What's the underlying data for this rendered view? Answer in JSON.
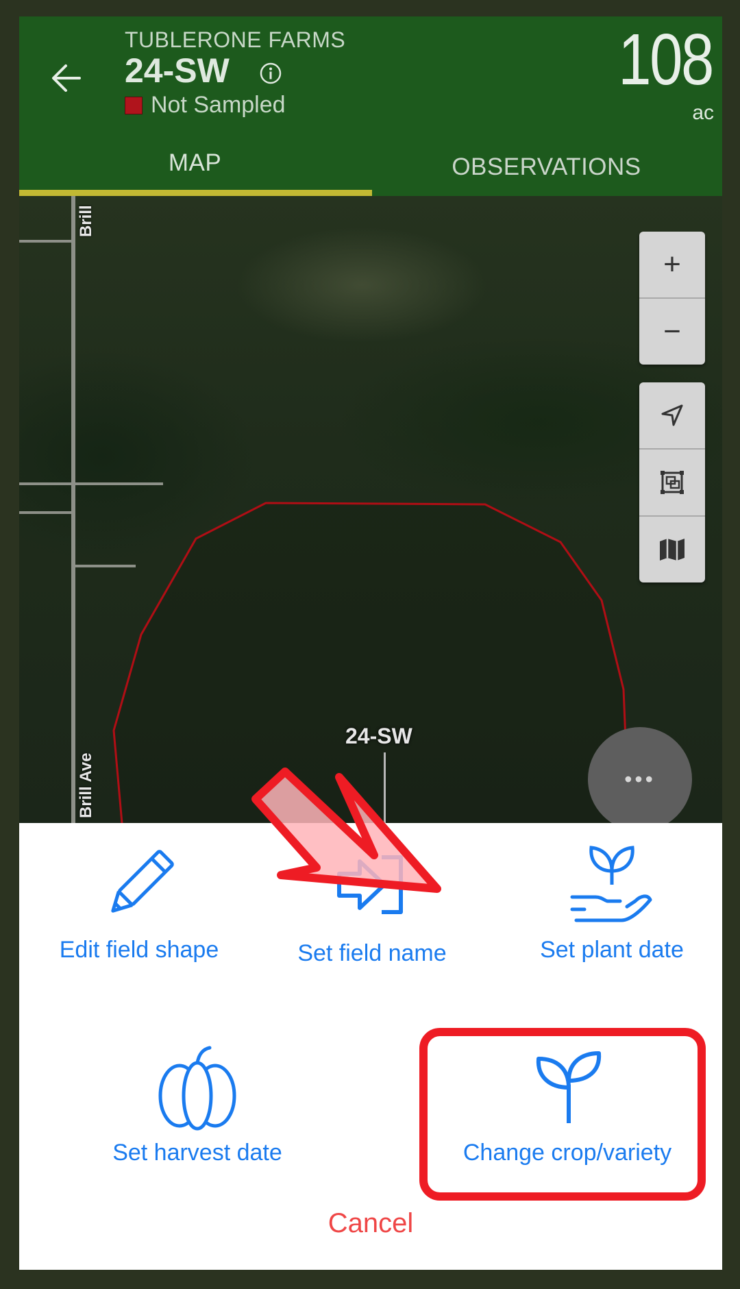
{
  "header": {
    "farm_name": "TUBLERONE FARMS",
    "field_name": "24-SW",
    "status": "Not Sampled",
    "status_color": "#b0141c",
    "acreage": "108",
    "acreage_unit": "ac",
    "bg_color": "#1d5a1d"
  },
  "tabs": [
    {
      "label": "MAP",
      "active": true
    },
    {
      "label": "OBSERVATIONS",
      "active": false
    }
  ],
  "map": {
    "road_labels": [
      "Brill",
      "Brill Ave"
    ],
    "field_label": "24-SW",
    "controls": [
      "plus-icon",
      "minus-icon",
      "location-arrow-icon",
      "fit-bounds-icon",
      "map-layers-icon"
    ]
  },
  "actions": {
    "edit_field_shape": "Edit field shape",
    "set_field_name": "Set field name",
    "set_plant_date": "Set plant date",
    "set_harvest_date": "Set harvest date",
    "change_crop_variety": "Change crop/variety",
    "cancel": "Cancel",
    "accent_color": "#1a7bef"
  }
}
